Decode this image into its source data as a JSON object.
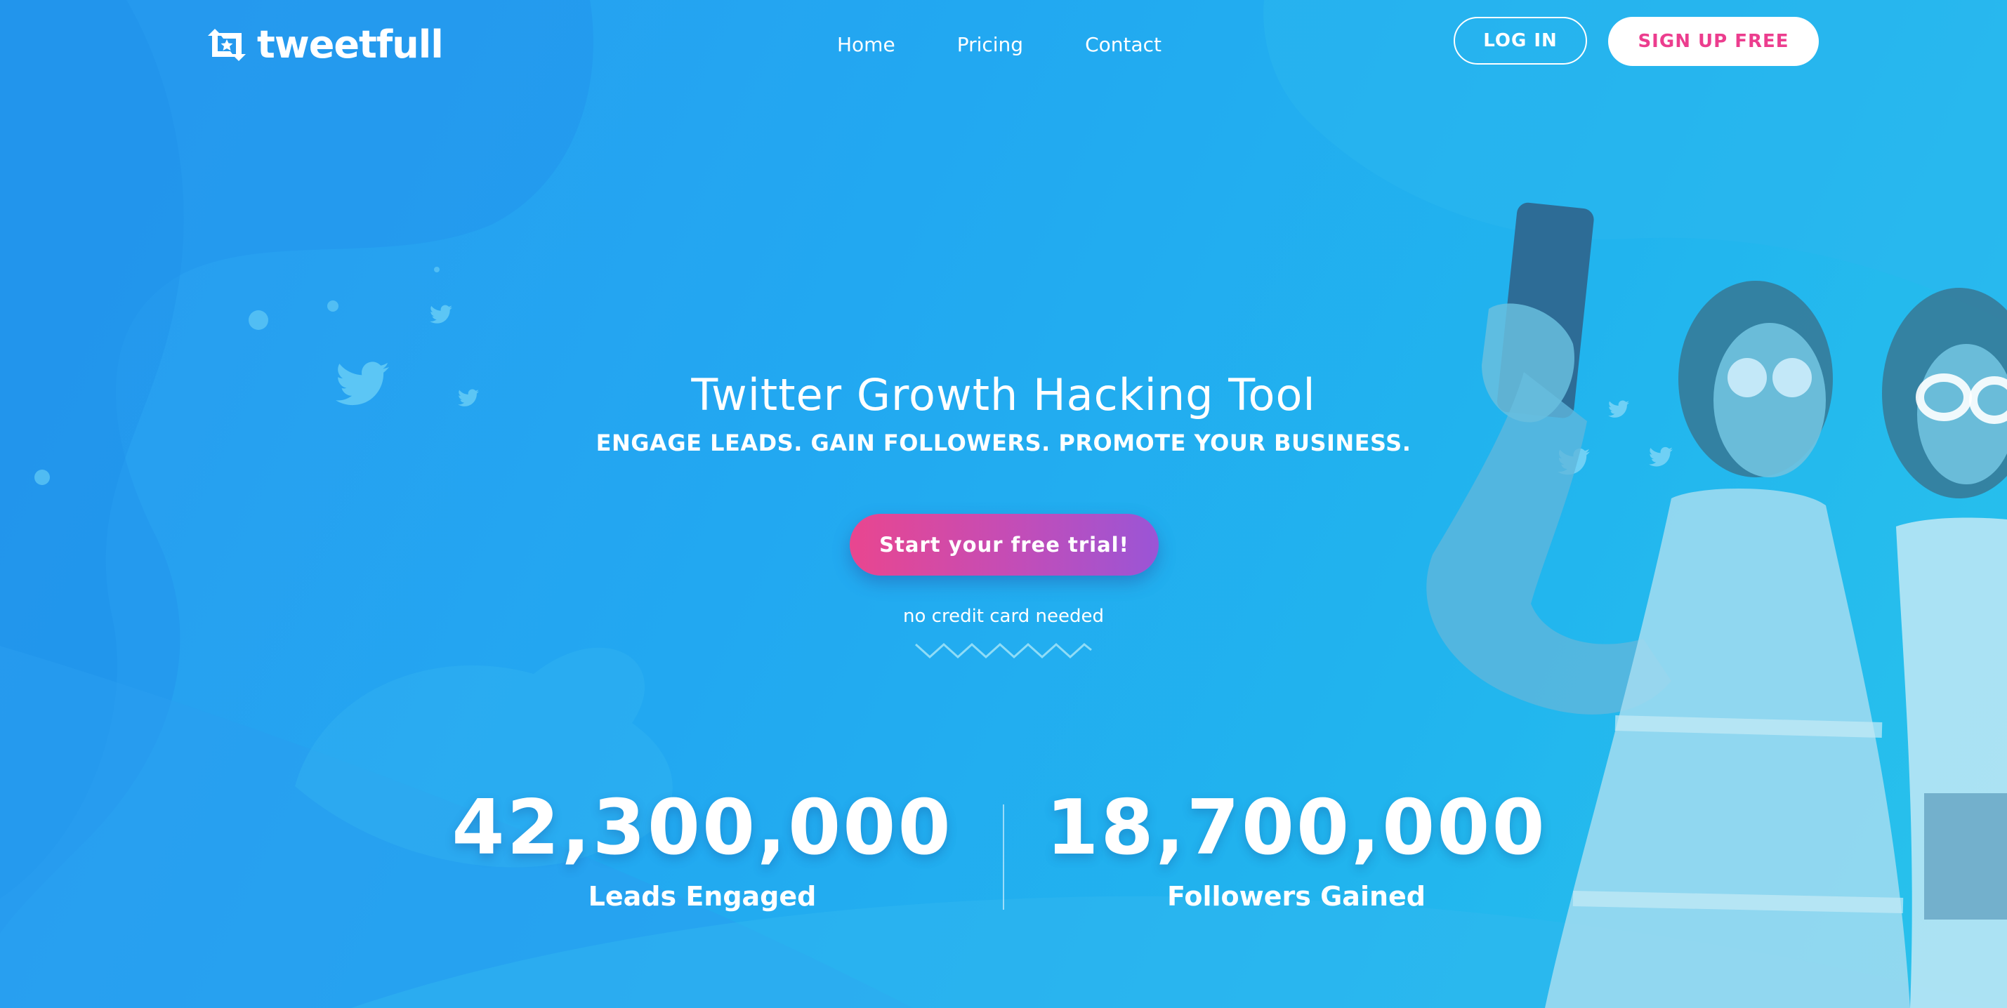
{
  "nav": {
    "logo_text": "tweetfull",
    "links": [
      {
        "label": "Home"
      },
      {
        "label": "Pricing"
      },
      {
        "label": "Contact"
      }
    ],
    "login_label": "LOG IN",
    "signup_label": "SIGN UP FREE"
  },
  "hero": {
    "title": "Twitter Growth Hacking Tool",
    "subtitle": "ENGAGE LEADS. GAIN FOLLOWERS. PROMOTE YOUR BUSINESS.",
    "cta_label": "Start your free trial!",
    "note": "no credit card needed"
  },
  "stats": [
    {
      "value": "42,300,000",
      "label": "Leads Engaged"
    },
    {
      "value": "18,700,000",
      "label": "Followers Gained"
    }
  ],
  "colors": {
    "background_start": "#2a9bf0",
    "background_end": "#29c3ec",
    "accent_pink": "#ec3d8e",
    "accent_purple": "#9a55d6"
  },
  "icons": {
    "logo": "retweet-star-icon",
    "decor": "twitter-bird-icon"
  }
}
